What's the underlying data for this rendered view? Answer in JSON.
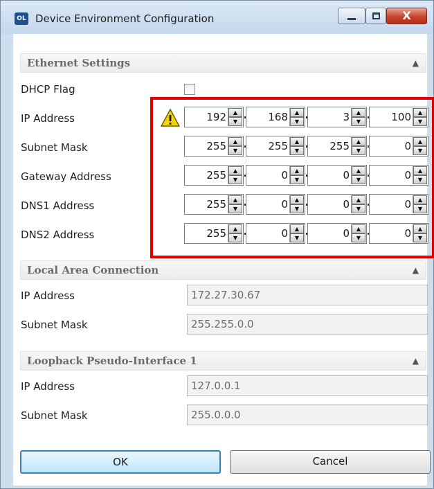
{
  "window": {
    "app_icon_text": "OL",
    "title": "Device Environment Configuration",
    "controls": {
      "minimize": "minimize",
      "maximize": "maximize",
      "close_glyph": "X"
    }
  },
  "ethernet": {
    "header": "Ethernet Settings",
    "dhcp_label": "DHCP Flag",
    "dhcp_checked": false,
    "ip_label": "IP Address",
    "ip_octets": [
      "192",
      "168",
      "3",
      "100"
    ],
    "subnet_label": "Subnet Mask",
    "subnet_octets": [
      "255",
      "255",
      "255",
      "0"
    ],
    "gateway_label": "Gateway Address",
    "gateway_octets": [
      "255",
      "0",
      "0",
      "0"
    ],
    "dns1_label": "DNS1 Address",
    "dns1_octets": [
      "255",
      "0",
      "0",
      "0"
    ],
    "dns2_label": "DNS2 Address",
    "dns2_octets": [
      "255",
      "0",
      "0",
      "0"
    ],
    "warning_icon": "warning-icon",
    "highlight_color": "#e00000"
  },
  "lan": {
    "header": "Local Area Connection",
    "ip_label": "IP Address",
    "ip_value": "172.27.30.67",
    "subnet_label": "Subnet Mask",
    "subnet_value": "255.255.0.0"
  },
  "loopback": {
    "header": "Loopback Pseudo-Interface 1",
    "ip_label": "IP Address",
    "ip_value": "127.0.0.1",
    "subnet_label": "Subnet Mask",
    "subnet_value": "255.0.0.0"
  },
  "buttons": {
    "ok": "OK",
    "cancel": "Cancel"
  },
  "icons": {
    "collapse": "chevron-up-icon",
    "spin_up": "spin-up-icon",
    "spin_down": "spin-down-icon"
  }
}
